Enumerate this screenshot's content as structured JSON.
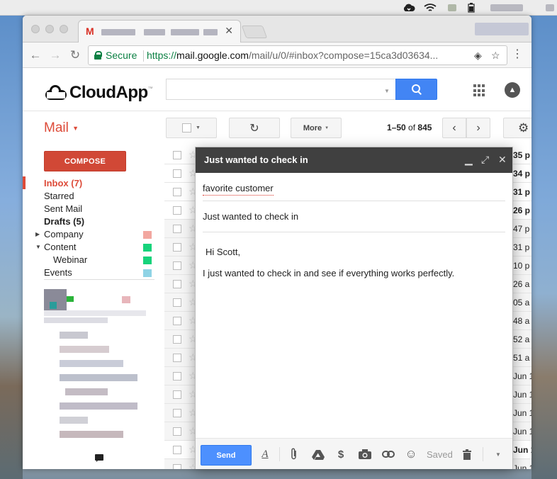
{
  "browser": {
    "tab_title_icon": "M",
    "secure_label": "Secure",
    "url_scheme": "https://",
    "url_host": "mail.google.com",
    "url_path": "/mail/u/0/#inbox?compose=15ca3d03634..."
  },
  "header": {
    "logo_text": "CloudApp",
    "logo_tm": "™",
    "search_placeholder": ""
  },
  "toolbar": {
    "mail_label": "Mail",
    "more_label": "More",
    "pager_range": "1–50",
    "pager_of": "of",
    "pager_total": "845"
  },
  "sidebar": {
    "compose_label": "COMPOSE",
    "items": [
      {
        "label": "Inbox (7)"
      },
      {
        "label": "Starred"
      },
      {
        "label": "Sent Mail"
      },
      {
        "label": "Drafts (5)"
      },
      {
        "label": "Company",
        "color": "#f2a7a0"
      },
      {
        "label": "Content",
        "color": "#16d37b"
      },
      {
        "label": "Webinar",
        "color": "#16d37b"
      },
      {
        "label": "Events",
        "color": "#8fd3e5"
      }
    ]
  },
  "messages": {
    "times": [
      "35 p",
      "34 p",
      "31 p",
      "26 p",
      "47 p",
      "31 p",
      "10 p",
      "26 a",
      "05 a",
      "48 a",
      "52 a",
      "51 a",
      "Jun 1",
      "Jun 1",
      "Jun 1",
      "Jun 1",
      "Jun 1",
      "Jun 1"
    ],
    "unread": [
      true,
      true,
      true,
      true,
      false,
      false,
      false,
      false,
      false,
      false,
      false,
      false,
      false,
      false,
      false,
      false,
      true,
      false
    ]
  },
  "compose": {
    "title": "Just wanted to check in",
    "to": "favorite customer",
    "subject": "Just wanted to check in",
    "greeting": "Hi Scott,",
    "body": "I just wanted to check in and see if everything works perfectly.",
    "send_label": "Send",
    "saved_label": "Saved",
    "format_glyph": "A"
  },
  "colors": {
    "compose_red": "#d14836",
    "send_blue": "#4d90fe",
    "mail_red": "#dd4b39",
    "secure_green": "#0b8043"
  }
}
